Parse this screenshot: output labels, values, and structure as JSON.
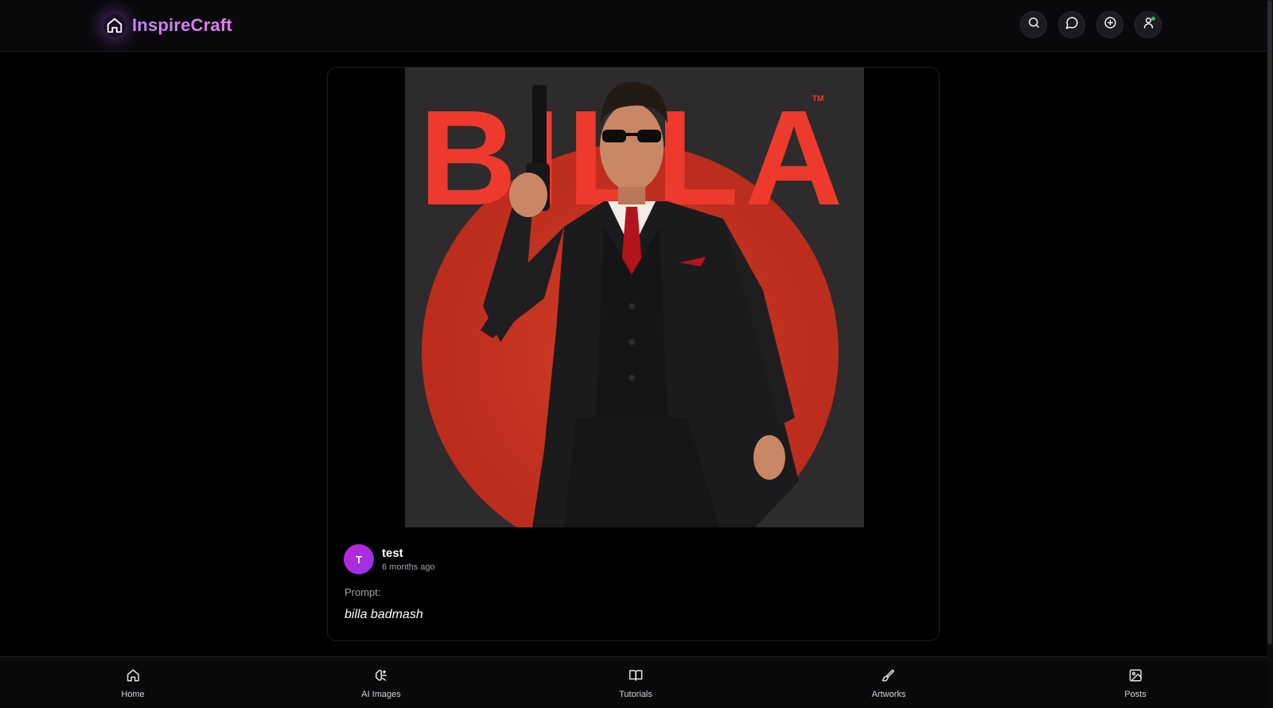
{
  "app": {
    "name": "InspireCraft",
    "brand_color": "#c084fc"
  },
  "top_actions": [
    {
      "name": "search",
      "icon": "search-icon"
    },
    {
      "name": "messages",
      "icon": "chat-bubble-icon"
    },
    {
      "name": "create",
      "icon": "plus-circle-icon"
    },
    {
      "name": "profile",
      "icon": "user-icon"
    }
  ],
  "post": {
    "artwork_title_text": "BILLA",
    "artwork_tm": "TM",
    "author": {
      "initial": "T",
      "name": "test",
      "time": "6 months ago"
    },
    "prompt_label": "Prompt:",
    "prompt_text": "billa badmash"
  },
  "bottom_nav": [
    {
      "label": "Home",
      "icon": "home-icon"
    },
    {
      "label": "AI Images",
      "icon": "brain-sparkle-icon"
    },
    {
      "label": "Tutorials",
      "icon": "book-open-icon"
    },
    {
      "label": "Artworks",
      "icon": "brush-icon"
    },
    {
      "label": "Posts",
      "icon": "image-icon"
    }
  ]
}
